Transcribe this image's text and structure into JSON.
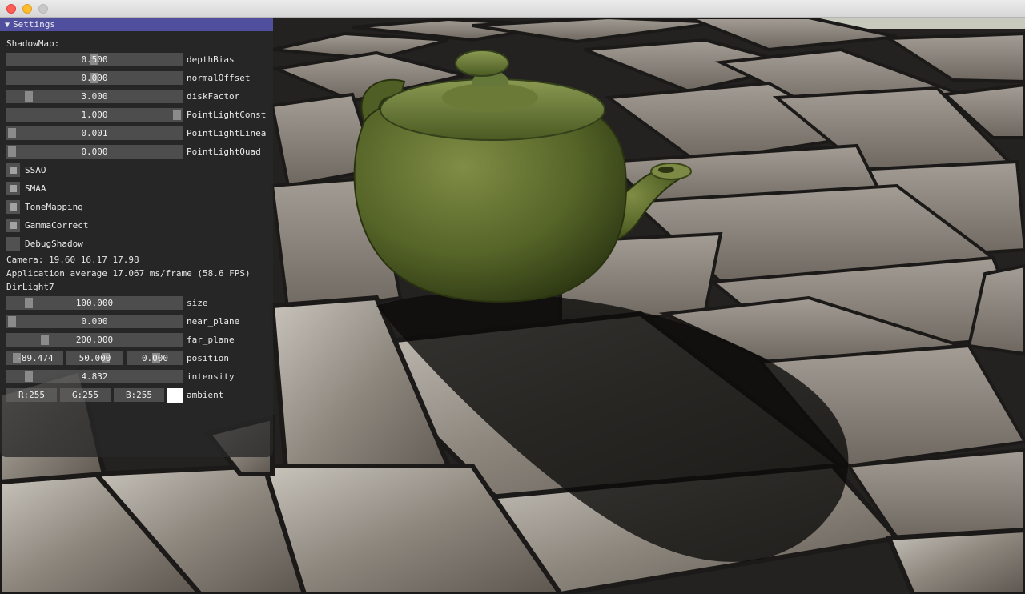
{
  "window": {
    "controls": [
      "close-icon",
      "minimize-icon",
      "maximize-icon"
    ]
  },
  "settings": {
    "title": "Settings",
    "collapse_icon": "triangle-down-icon",
    "shadowmap_header": "ShadowMap:",
    "sliders": [
      {
        "value": "0.500",
        "label": "depthBias",
        "fraction": 0.5
      },
      {
        "value": "0.000",
        "label": "normalOffset",
        "fraction": 0.5
      },
      {
        "value": "3.000",
        "label": "diskFactor",
        "fraction": 0.1
      },
      {
        "value": "1.000",
        "label": "PointLightConst",
        "fraction": 1.0
      },
      {
        "value": "0.001",
        "label": "PointLightLinea",
        "fraction": 0.0
      },
      {
        "value": "0.000",
        "label": "PointLightQuad",
        "fraction": 0.0
      }
    ],
    "checkboxes": [
      {
        "label": "SSAO",
        "checked": true
      },
      {
        "label": "SMAA",
        "checked": true
      },
      {
        "label": "ToneMapping",
        "checked": true
      },
      {
        "label": "GammaCorrect",
        "checked": true
      },
      {
        "label": "DebugShadow",
        "checked": false
      }
    ],
    "camera_text": "Camera: 19.60 16.17 17.98",
    "fps_text": "Application average 17.067 ms/frame (58.6 FPS)",
    "dirlight_header": "DirLight7",
    "light_sliders": [
      {
        "value": "100.000",
        "label": "size",
        "fraction": 0.1
      },
      {
        "value": "0.000",
        "label": "near_plane",
        "fraction": 0.0
      },
      {
        "value": "200.000",
        "label": "far_plane",
        "fraction": 0.2
      }
    ],
    "position": {
      "values": [
        "-89.474",
        "50.000",
        "0.000"
      ],
      "label": "position"
    },
    "intensity": {
      "value": "4.832",
      "label": "intensity",
      "fraction": 0.1
    },
    "ambient": {
      "r": "R:255",
      "g": "G:255",
      "b": "B:255",
      "label": "ambient",
      "color": "#ffffff"
    }
  },
  "colors": {
    "title_bar": "#4f4f9e",
    "teapot": "#5a6b2c"
  }
}
